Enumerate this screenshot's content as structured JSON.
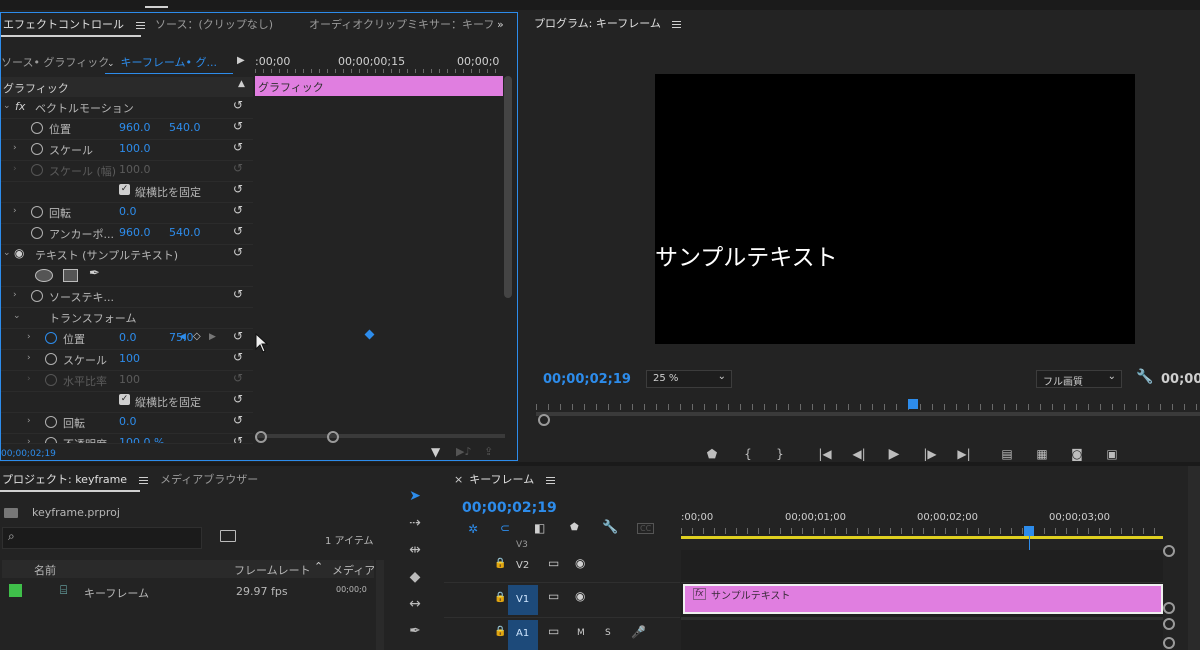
{
  "top_bar": {},
  "effect_controls": {
    "tabs": [
      {
        "label": "エフェクトコントロール",
        "active": true
      },
      {
        "label": "ソース：(クリップなし)",
        "active": false
      },
      {
        "label": "オーディオクリップミキサー：キーフ",
        "active": false
      }
    ],
    "overflow": "»",
    "source_label": "ソース• グラフィック",
    "clip_label": "キーフレーム• グ...",
    "time_start": ":00;00",
    "time_mid": "00;00;00;15",
    "time_end": "00;00;0",
    "section_header": "グラフィック",
    "clip_bar_label": "グラフィック",
    "rows": [
      {
        "label": "ベクトルモーション",
        "fx": "fx"
      },
      {
        "label": "位置",
        "v1": "960.0",
        "v2": "540.0"
      },
      {
        "label": "スケール",
        "v1": "100.0"
      },
      {
        "label": "スケール (幅)",
        "v1": "100.0"
      },
      {
        "checkbox_label": "縦横比を固定"
      },
      {
        "label": "回転",
        "v1": "0.0"
      },
      {
        "label": "アンカーポ...",
        "v1": "960.0",
        "v2": "540.0"
      },
      {
        "label": "テキスト (サンプルテキスト)"
      },
      {},
      {
        "label": "ソーステキ..."
      },
      {
        "label": "トランスフォーム"
      },
      {
        "label": "位置",
        "v1": "0.0",
        "v2": "75.0"
      },
      {
        "label": "スケール",
        "v1": "100"
      },
      {
        "label": "水平比率",
        "v1": "100"
      },
      {
        "checkbox_label": "縦横比を固定"
      },
      {
        "label": "回転",
        "v1": "0.0"
      },
      {
        "label": "不透明度",
        "v1": "100.0 %"
      }
    ],
    "bottom_timecode": "00;00;02;19"
  },
  "program_monitor": {
    "title": "プログラム: キーフレーム",
    "overlay_text": "サンプルテキスト",
    "timecode": "00;00;02;19",
    "zoom": "25 %",
    "quality": "フル画質",
    "timecode_right": "00;00;"
  },
  "project": {
    "tabs": [
      {
        "label": "プロジェクト: keyframe",
        "active": true
      },
      {
        "label": "メディアブラウザー",
        "active": false
      }
    ],
    "file_name": "keyframe.prproj",
    "item_count": "1 アイテム",
    "search_placeholder": "",
    "columns": [
      "名前",
      "フレームレート",
      "メディア"
    ],
    "items": [
      {
        "name": "キーフレーム",
        "frame_rate": "29.97 fps",
        "media": "00;00;0"
      }
    ],
    "swatch_color": "#3fbf4a"
  },
  "timeline": {
    "title": "キーフレーム",
    "timecode": "00;00;02;19",
    "ruler": [
      ":00;00",
      "00;00;01;00",
      "00;00;02;00",
      "00;00;03;00"
    ],
    "tracks": [
      {
        "name": "V3"
      },
      {
        "name": "V2"
      },
      {
        "name": "V1"
      },
      {
        "name": "A1",
        "m": "M",
        "s": "S"
      }
    ],
    "clip_label": "サンプルテキスト",
    "clip_fx": "fx",
    "cc_label": "CC"
  },
  "colors": {
    "accent": "#2d8ceb",
    "clip_pink": "#e07ee0",
    "bg": "#232323",
    "yellow": "#e0d020"
  }
}
